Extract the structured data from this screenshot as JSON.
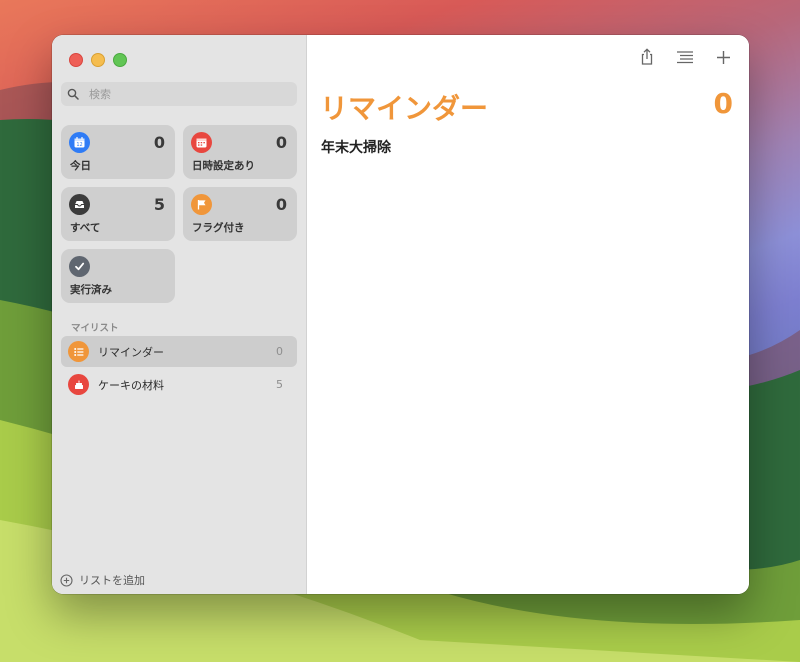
{
  "colors": {
    "accent": "#f0963a",
    "today": "#2f7cf6",
    "scheduled": "#e8473f",
    "all": "#3c3c3c",
    "flagged": "#f0963a",
    "completed": "#5f6670",
    "list_reminders": "#f0963a",
    "list_cake": "#e8473f"
  },
  "sidebar": {
    "search_placeholder": "検索",
    "smart_lists": [
      {
        "label": "今日",
        "count": "0",
        "icon": "calendar-today-icon"
      },
      {
        "label": "日時設定あり",
        "count": "0",
        "icon": "calendar-icon"
      },
      {
        "label": "すべて",
        "count": "5",
        "icon": "tray-icon"
      },
      {
        "label": "フラグ付き",
        "count": "0",
        "icon": "flag-icon"
      },
      {
        "label": "実行済み",
        "icon": "checkmark-icon"
      }
    ],
    "section_label": "マイリスト",
    "lists": [
      {
        "label": "リマインダー",
        "count": "0",
        "icon": "list-icon"
      },
      {
        "label": "ケーキの材料",
        "count": "5",
        "icon": "cake-icon"
      }
    ],
    "add_list_label": "リストを追加"
  },
  "main": {
    "title": "リマインダー",
    "count": "0",
    "section_header": "年末大掃除"
  }
}
